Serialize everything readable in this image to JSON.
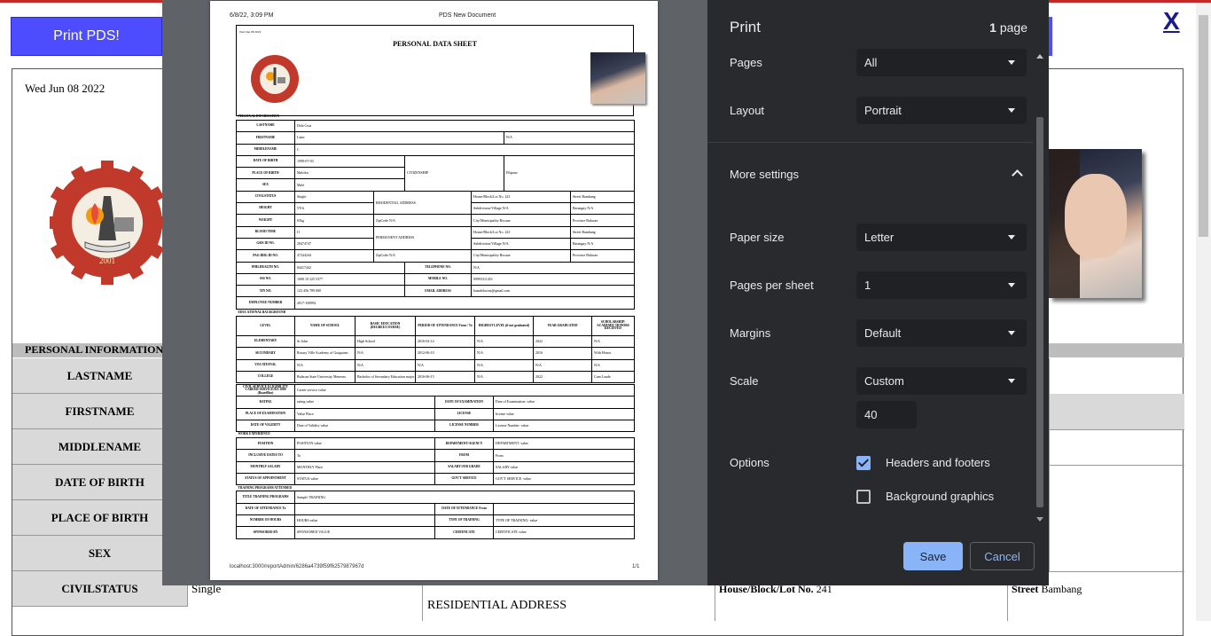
{
  "background_page": {
    "print_button": "Print PDS!",
    "close_label": "X",
    "date": "Wed Jun 08 2022",
    "section_header": "PERSONAL INFORMATION",
    "rows": [
      "LASTNAME",
      "FIRSTNAME",
      "MIDDLENAME",
      "DATE OF BIRTH",
      "PLACE OF BIRTH",
      "SEX",
      "CIVILSTATUS"
    ],
    "civilstatus_value": "Single",
    "residential_address": "RESIDENTIAL ADDRESS",
    "house_label": "House/Block/Lot No.",
    "house_value": "241",
    "street_label": "Street",
    "street_value": "Bambang",
    "logo_text": "COLLEGE OF INFORMATION AND COMMUNICATION",
    "logo_bottom": "BULACAN STATE UNIVERSITY",
    "logo_year": "2001"
  },
  "preview": {
    "header_left": "6/8/22, 3:09 PM",
    "header_center": "PDS New Document",
    "footer_left": "localhost:3000/reportAdmin/6286a4739f59f6257987967d",
    "footer_right": "1/1",
    "date_small": "Wed Jun 08 2022",
    "title": "PERSONAL DATA SHEET",
    "section_personal": "PERSONAL INFORMATION",
    "lastname_label": "LASTNAME",
    "lastname": "Dela Cruz",
    "firstname_label": "FIRSTNAME",
    "firstname": "Liam",
    "firstname_ext": "N/A",
    "middlename_label": "MIDDLENAME",
    "middlename": "C",
    "dob_label": "DATE OF BIRTH",
    "dob": "1999-07-03",
    "pob_label": "PLACE OF BIRTH",
    "pob": "Malolos",
    "citizenship_label": "CITIZENSHIP",
    "citizenship": "Filipino",
    "sex_label": "SEX",
    "sex": "Male",
    "civil_label": "CIVILSTATUS",
    "civil": "Single",
    "height_label": "HEIGHT",
    "height": "5'8 ft",
    "weight_label": "WEIGHT",
    "weight": "65kg",
    "blood_label": "BLOOD TIME",
    "blood": "O",
    "gsis_label": "GSIS ID NO.",
    "gsis": "28474747",
    "pagibig_label": "PAG-IBIG ID NO.",
    "pagibig": "47244244",
    "res_addr": "RESIDENTIAL ADDRESS",
    "perm_addr": "PERMANENT ADDRESS",
    "house": "House/Block/Lot No. 241",
    "street": "Street Bambang",
    "subdivision": "Subdivision/Village N/A",
    "barangay": "Barangay N/A",
    "zip": "ZipCode N/A",
    "city": "City/Municipality Bocaue",
    "province": "Province Bulacan",
    "philhealth_label": "PHILHEALTH NO.",
    "philhealth": "84417442",
    "sss_label": "SSS NO.",
    "sss": "1000 10 225 5377",
    "tin_label": "TIN NO.",
    "tin": "123 456 789 000",
    "employee_label": "EMPLOYEE NUMBER",
    "employee": "2017-100992",
    "tel_label": "TELEPHONE NO.",
    "tel": "N/A",
    "mobile_label": "MOBILE NO.",
    "mobile": "09993311451",
    "email_label": "EMAIL ADDRESS",
    "email": "liamdelacruz@gmail.com",
    "section_edu": "EDUCATIONAL BACKGROUND",
    "edu_headers": [
      "LEVEL",
      "NAME OF SCHOOL",
      "BASIC EDUCATION (DEGREE/COURSE)",
      "PERIOD OF ATTENDANCE From / To",
      "HIGHEST LEVEL (if not graduated)",
      "YEAR GRADUATED",
      "SCHOLARSHIP/ ACADEMIC HONORS RECEIVED"
    ],
    "edu_rows": [
      [
        "ELEMENTARY",
        "St.John",
        "High School",
        "2016-02-14",
        "2022-06-17",
        "N/A",
        "2022",
        "N/A"
      ],
      [
        "SECONDARY",
        "Rosary Ville Academy of Guiguinto",
        "N/A",
        "2012-06-10",
        "2016-03-20",
        "N/A",
        "2016",
        "With Honor"
      ],
      [
        "VOCATIONAL",
        "N/A",
        "N/A",
        "N/A",
        "N/A",
        "N/A",
        "N/A",
        "N/A"
      ],
      [
        "COLLEGE",
        "Bulacan State University Meneses",
        "Bachelor of Secondary Education major in English",
        "2016-06-15",
        "2022-03-25",
        "N/A",
        "2022",
        "Cum Laude"
      ]
    ],
    "cse_label": "CIVIL SERVICE ELIGIBILITY CAREER SERVICE/RA 1080 (BoardBar)",
    "cse": "Career service value",
    "rating_label": "RATING",
    "rating": "rating value",
    "exam_date_label": "DATE OF EXAMINATION",
    "exam_date": "Date of Examination: value",
    "exam_place_label": "PLACE OF EXAMINATION",
    "exam_place": "Value Place",
    "license_label": "LICENSE",
    "license": "license value",
    "validity_label": "DATE OF VALIDITY",
    "validity": "Date of Validity value",
    "license_no_label": "LICENSE NUMBER",
    "license_no": "License Number: value",
    "section_work": "WORK EXPERIENCE",
    "position_label": "POSITION",
    "position": "POSITION value",
    "dept_label": "DEPARTMENT/AGENCY",
    "dept": "DEPARTMENT: value",
    "dates_label": "INCLUSIVE DATES TO",
    "dates": "To",
    "from_label": "FROM",
    "from": "From",
    "salary_label": "MONTHLY SALARY",
    "salary": "MONTHLY Place",
    "grade_label": "SALARY/JOB GRADE",
    "grade": "SALARY value",
    "appt_label": "STATUS OF APPOINTMENT",
    "appt": "STATUS value",
    "govt_label": "GOV'T SERVICE",
    "govt": "GOV'T SERVICE: value",
    "section_training": "TRAINING PROGRAMS ATTENDED",
    "training_title_label": "TITLE TRAINING PROGRAMS",
    "training_title": "Sample TRAINING",
    "att_to_label": "DATE OF ATTENDANCE To",
    "att_from_label": "DATE OF ATTENDANCE From",
    "hours_label": "NUMBER OF HOURS",
    "hours": "HOURS value",
    "type_label": "TYPE OF TRAINING",
    "type": "TYPE OF TRAINING: value",
    "sponsor_label": "SPONSORED BY",
    "sponsor": "SPONSORED VALUE",
    "cert_label": "CERTIFICATE",
    "cert": "CERTIFICATE value"
  },
  "print_panel": {
    "title": "Print",
    "page_count": "1",
    "page_word": "page",
    "pages_label": "Pages",
    "pages_value": "All",
    "layout_label": "Layout",
    "layout_value": "Portrait",
    "more_settings": "More settings",
    "paper_label": "Paper size",
    "paper_value": "Letter",
    "pps_label": "Pages per sheet",
    "pps_value": "1",
    "margins_label": "Margins",
    "margins_value": "Default",
    "scale_label": "Scale",
    "scale_value": "Custom",
    "scale_custom": "40",
    "options_label": "Options",
    "headers_footers": "Headers and footers",
    "headers_footers_checked": true,
    "bg_graphics": "Background graphics",
    "bg_graphics_checked": false,
    "save": "Save",
    "cancel": "Cancel",
    "accent_color": "#8ab4f8"
  }
}
